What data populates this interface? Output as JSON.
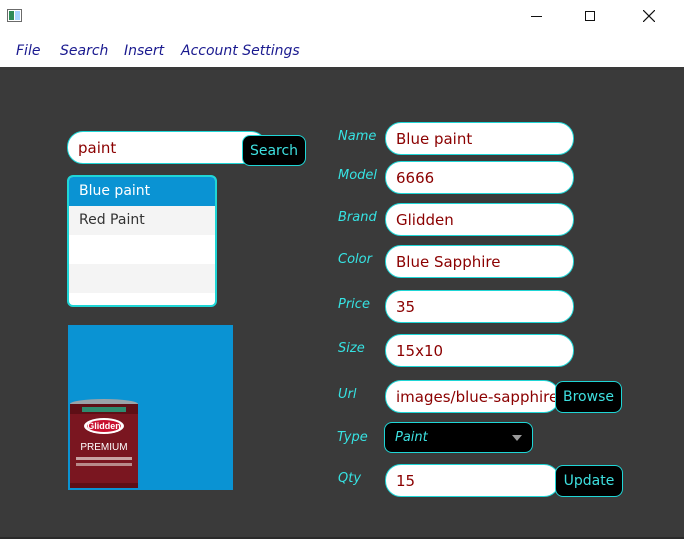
{
  "menu": {
    "file": "File",
    "search": "Search",
    "insert": "Insert",
    "account": "Account Settings"
  },
  "search": {
    "query": "paint",
    "button": "Search"
  },
  "results": [
    "Blue paint",
    "Red Paint"
  ],
  "image": {
    "brand_text": "Glidden",
    "product_text": "PREMIUM"
  },
  "form": {
    "name_label": "Name",
    "name_value": "Blue paint",
    "model_label": "Model",
    "model_value": "6666",
    "brand_label": "Brand",
    "brand_value": "Glidden",
    "color_label": "Color",
    "color_value": "Blue Sapphire",
    "price_label": "Price",
    "price_value": "35",
    "size_label": "Size",
    "size_value": "15x10",
    "url_label": "Url",
    "url_value": "images/blue-sapphire-g",
    "browse_button": "Browse",
    "type_label": "Type",
    "type_value": "Paint",
    "qty_label": "Qty",
    "qty_value": "15",
    "update_button": "Update"
  },
  "colors": {
    "accent": "#1fd6d6",
    "background": "#3a3a3a",
    "selection": "#0a93d3",
    "value_text": "#8b0000"
  }
}
